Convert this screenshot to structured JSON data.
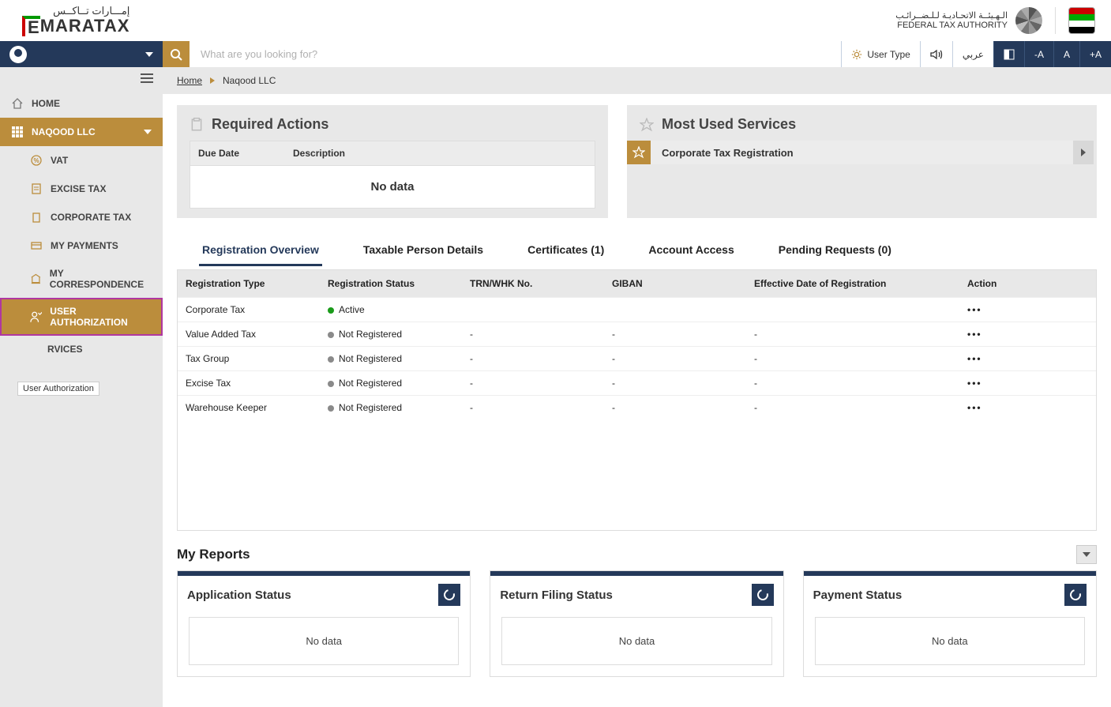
{
  "header": {
    "logo_ar": "إمـــارات تــاكــس",
    "logo_en": "MARATAX",
    "fta_ar": "الـهـيئــة الاتحـاديـة لـلـضــرائـب",
    "fta_en": "FEDERAL TAX AUTHORITY"
  },
  "nav": {
    "search_placeholder": "What are you looking for?",
    "user_type": "User Type",
    "lang": "عربي",
    "dec": "-A",
    "reset": "A",
    "inc": "+A"
  },
  "breadcrumb": {
    "home": "Home",
    "current": "Naqood LLC"
  },
  "sidebar": {
    "home": "HOME",
    "company": "NAQOOD LLC",
    "items": [
      "VAT",
      "EXCISE TAX",
      "CORPORATE TAX",
      "MY PAYMENTS",
      "MY CORRESPONDENCE",
      "USER AUTHORIZATION",
      "RVICES"
    ],
    "tooltip": "User Authorization"
  },
  "required_actions": {
    "title": "Required Actions",
    "col_due": "Due Date",
    "col_desc": "Description",
    "no_data": "No data"
  },
  "services": {
    "title": "Most Used Services",
    "items": [
      "Corporate Tax Registration"
    ]
  },
  "tabs": [
    "Registration Overview",
    "Taxable Person Details",
    "Certificates (1)",
    "Account Access",
    "Pending Requests (0)"
  ],
  "registration": {
    "columns": [
      "Registration Type",
      "Registration Status",
      "TRN/WHK No.",
      "GIBAN",
      "Effective Date of Registration",
      "Action"
    ],
    "rows": [
      {
        "type": "Corporate Tax",
        "status": "Active",
        "dot": "green",
        "trn": "",
        "giban": "",
        "eff": "",
        "action": "•••"
      },
      {
        "type": "Value Added Tax",
        "status": "Not Registered",
        "dot": "grey",
        "trn": "-",
        "giban": "-",
        "eff": "-",
        "action": "•••"
      },
      {
        "type": "Tax Group",
        "status": "Not Registered",
        "dot": "grey",
        "trn": "-",
        "giban": "-",
        "eff": "-",
        "action": "•••"
      },
      {
        "type": "Excise Tax",
        "status": "Not Registered",
        "dot": "grey",
        "trn": "-",
        "giban": "-",
        "eff": "-",
        "action": "•••"
      },
      {
        "type": "Warehouse Keeper",
        "status": "Not Registered",
        "dot": "grey",
        "trn": "-",
        "giban": "-",
        "eff": "-",
        "action": "•••"
      }
    ]
  },
  "reports": {
    "title": "My Reports",
    "cards": [
      {
        "title": "Application Status",
        "body": "No data"
      },
      {
        "title": "Return Filing Status",
        "body": "No data"
      },
      {
        "title": "Payment Status",
        "body": "No data"
      }
    ]
  }
}
